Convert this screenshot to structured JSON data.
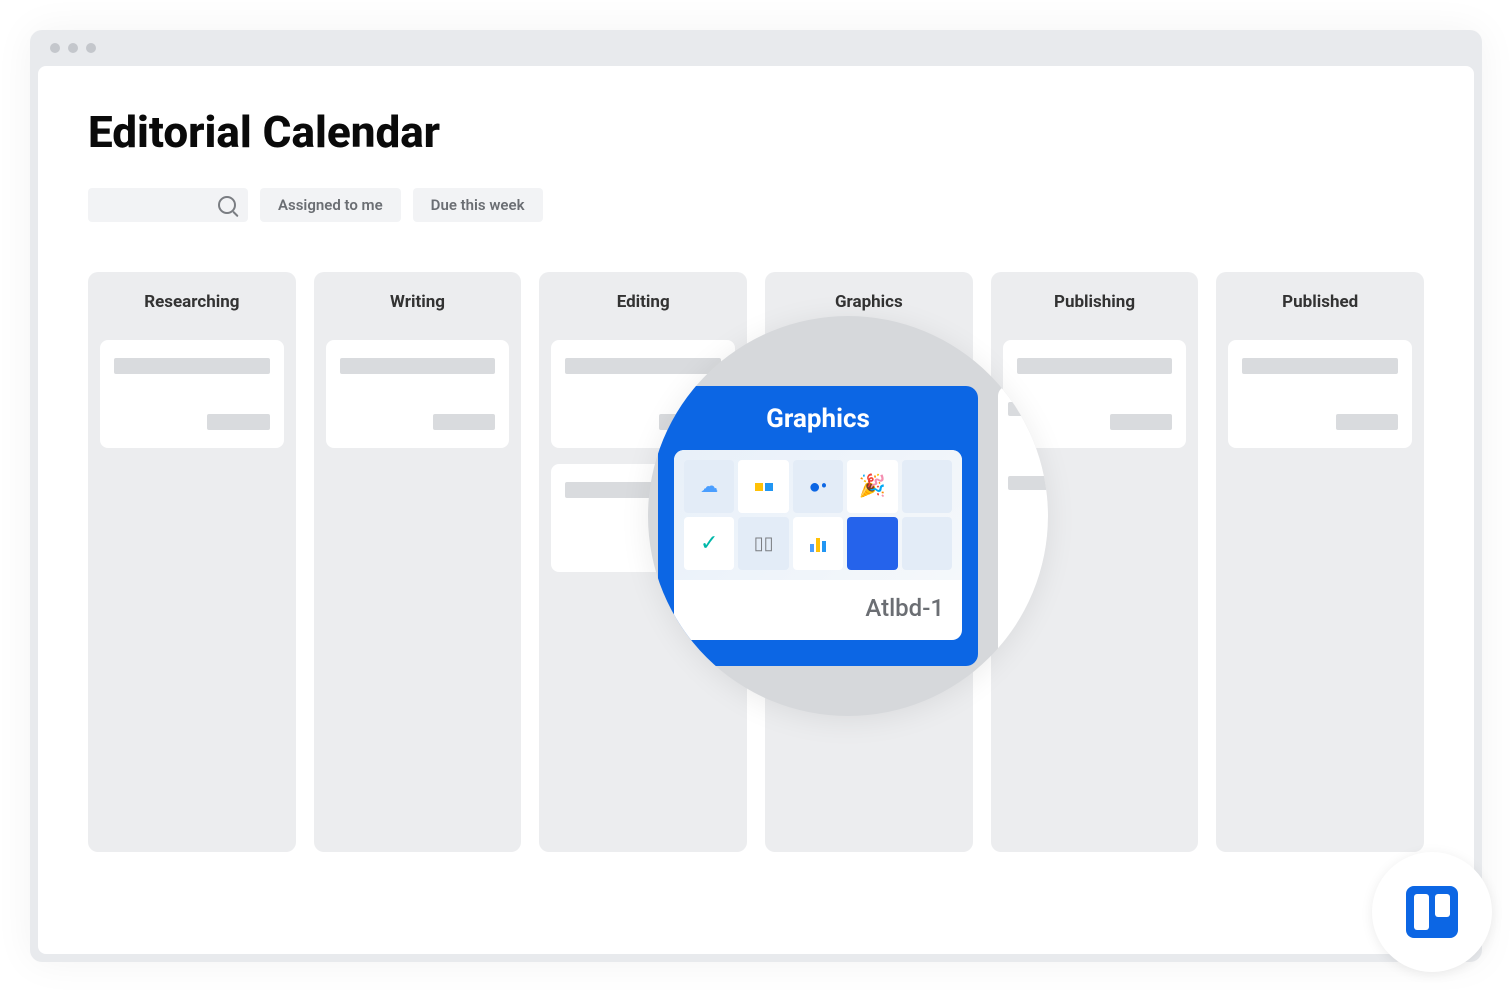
{
  "page": {
    "title": "Editorial Calendar"
  },
  "filters": {
    "assigned": "Assigned to me",
    "due": "Due this week"
  },
  "columns": [
    {
      "label": "Researching"
    },
    {
      "label": "Writing"
    },
    {
      "label": "Editing"
    },
    {
      "label": "Graphics"
    },
    {
      "label": "Publishing"
    },
    {
      "label": "Published"
    }
  ],
  "magnifier": {
    "column_title": "Graphics",
    "card_id": "Atlbd-1"
  },
  "colors": {
    "accent": "#0c66e4"
  }
}
